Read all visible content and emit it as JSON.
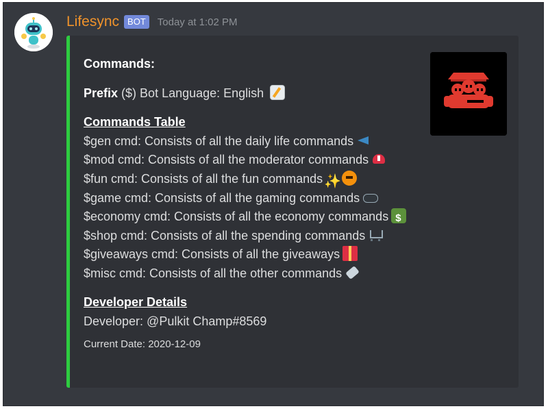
{
  "message": {
    "username": "Lifesync",
    "badge": "BOT",
    "timestamp": "Today at 1:02 PM"
  },
  "colors": {
    "background": "#36393f",
    "embed_bg": "#2f3136",
    "embed_accent": "#2ecc40",
    "username": "#f0932b",
    "badge": "#7289da"
  },
  "embed": {
    "title": "Commands:",
    "prefix_label": "Prefix",
    "prefix_value": "($) Bot Language: English",
    "commands_heading": "Commands Table",
    "commands": [
      {
        "text": "$gen cmd: Consists of all the daily life commands",
        "icon": "megaphone-icon"
      },
      {
        "text": "$mod cmd: Consists of all the moderator commands",
        "icon": "rescue-helmet-icon"
      },
      {
        "text": "$fun cmd: Consists of all the fun commands",
        "icon": "sparkles-pumpkin-icon"
      },
      {
        "text": "$game cmd: Consists of all the gaming commands",
        "icon": "game-controller-icon"
      },
      {
        "text": "$economy cmd: Consists of all the economy commands",
        "icon": "money-icon"
      },
      {
        "text": "$shop cmd: Consists of all the spending commands",
        "icon": "shopping-cart-icon"
      },
      {
        "text": "$giveaways cmd: Consists of all the giveaways",
        "icon": "gift-icon"
      },
      {
        "text": "$misc cmd: Consists of all the other commands",
        "icon": "pill-icon"
      }
    ],
    "developer_heading": "Developer Details",
    "developer": "Developer: @Pulkit Champ#8569",
    "footer": "Current Date: 2020-12-09"
  }
}
